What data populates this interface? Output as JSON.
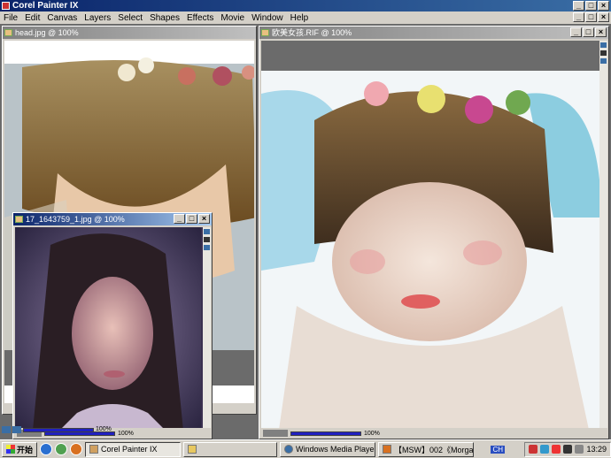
{
  "app": {
    "title": "Corel Painter IX"
  },
  "menu": [
    "File",
    "Edit",
    "Canvas",
    "Layers",
    "Select",
    "Shapes",
    "Effects",
    "Movie",
    "Window",
    "Help"
  ],
  "docs": {
    "head": {
      "title": "head.jpg @ 100%"
    },
    "portrait": {
      "title": "17_1643759_1.jpg @ 100%",
      "zoom": "100%"
    },
    "painting": {
      "title": "欧美女孩.RIF @ 100%",
      "zoom": "100%"
    }
  },
  "head_zoom": "100%",
  "taskbar": {
    "start": "开始",
    "tasks": [
      "Corel Painter IX",
      "",
      "Windows Media Player",
      "【MSW】002《Morgan ..."
    ],
    "ime": "CH",
    "clock": "13:29"
  }
}
